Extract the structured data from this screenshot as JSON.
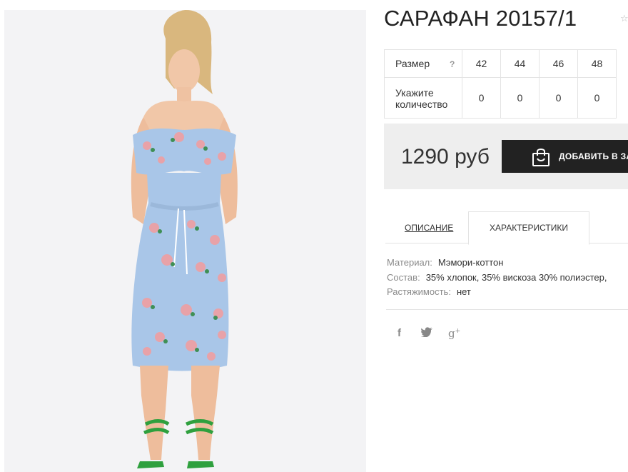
{
  "product": {
    "title": "САРАФАН 20157/1",
    "image_alt": "Сарафан"
  },
  "sizes": {
    "label": "Размер",
    "help": "?",
    "values": [
      "42",
      "44",
      "46",
      "48"
    ],
    "qty_label": "Укажите количество",
    "qty_values": [
      "0",
      "0",
      "0",
      "0"
    ]
  },
  "buy": {
    "price": "1290 руб",
    "cart_button": "ДОБАВИТЬ В ЗАКАЗ"
  },
  "tabs": {
    "description": "ОПИСАНИЕ",
    "characteristics": "ХАРАКТЕРИСТИКИ"
  },
  "specs": [
    {
      "key": "Материал:",
      "value": "Мэмори-коттон"
    },
    {
      "key": "Состав:",
      "value": "35% хлопок, 35% вискоза 30% полиэстер,"
    },
    {
      "key": "Растяжимость:",
      "value": "нет"
    }
  ],
  "social": {
    "facebook": "f",
    "twitter": "🐦",
    "googleplus": "g"
  },
  "colors": {
    "button_bg": "#222222",
    "panel_bg": "#eeeeee",
    "dress": "#a9c6e8",
    "rose": "#e8a2a8",
    "leaf": "#3f8f55",
    "sandal": "#2fa03e"
  }
}
